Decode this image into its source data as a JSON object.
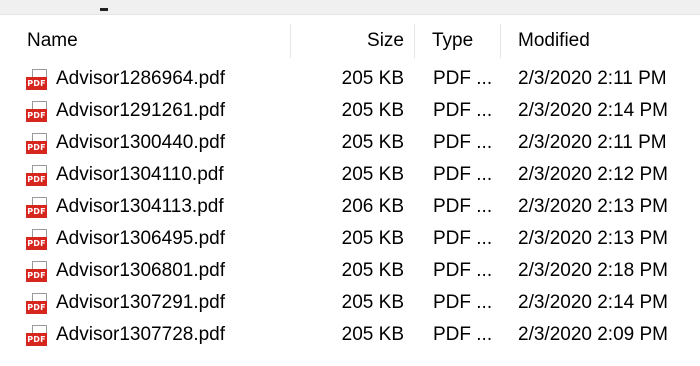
{
  "header": {
    "name": "Name",
    "size": "Size",
    "type": "Type",
    "modified": "Modified"
  },
  "icons": {
    "file": "pdf-file-icon",
    "badge_text": "PDF",
    "badge_color": "#d7261e"
  },
  "files": [
    {
      "name": "Advisor1286964.pdf",
      "size": "205 KB",
      "type": "PDF ...",
      "modified": "2/3/2020 2:11 PM"
    },
    {
      "name": "Advisor1291261.pdf",
      "size": "205 KB",
      "type": "PDF ...",
      "modified": "2/3/2020 2:14 PM"
    },
    {
      "name": "Advisor1300440.pdf",
      "size": "205 KB",
      "type": "PDF ...",
      "modified": "2/3/2020 2:11 PM"
    },
    {
      "name": "Advisor1304110.pdf",
      "size": "205 KB",
      "type": "PDF ...",
      "modified": "2/3/2020 2:12 PM"
    },
    {
      "name": "Advisor1304113.pdf",
      "size": "206 KB",
      "type": "PDF ...",
      "modified": "2/3/2020 2:13 PM"
    },
    {
      "name": "Advisor1306495.pdf",
      "size": "205 KB",
      "type": "PDF ...",
      "modified": "2/3/2020 2:13 PM"
    },
    {
      "name": "Advisor1306801.pdf",
      "size": "205 KB",
      "type": "PDF ...",
      "modified": "2/3/2020 2:18 PM"
    },
    {
      "name": "Advisor1307291.pdf",
      "size": "205 KB",
      "type": "PDF ...",
      "modified": "2/3/2020 2:14 PM"
    },
    {
      "name": "Advisor1307728.pdf",
      "size": "205 KB",
      "type": "PDF ...",
      "modified": "2/3/2020 2:09 PM"
    }
  ]
}
